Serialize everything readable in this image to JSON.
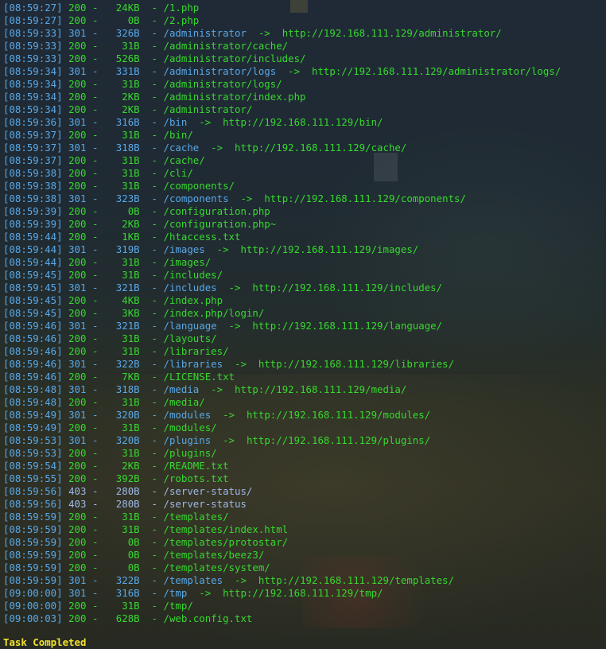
{
  "colors": {
    "status_200": "#37d82f",
    "status_301": "#58a8e8",
    "status_403": "#9fb8e8",
    "task_text": "#f2e12c"
  },
  "scan_results": [
    {
      "time": "[08:59:27]",
      "code": "200",
      "size": "24KB",
      "path": "/1.php",
      "redirect": ""
    },
    {
      "time": "[08:59:27]",
      "code": "200",
      "size": "0B",
      "path": "/2.php",
      "redirect": ""
    },
    {
      "time": "[08:59:33]",
      "code": "301",
      "size": "326B",
      "path": "/administrator",
      "redirect": "http://192.168.111.129/administrator/"
    },
    {
      "time": "[08:59:33]",
      "code": "200",
      "size": "31B",
      "path": "/administrator/cache/",
      "redirect": ""
    },
    {
      "time": "[08:59:33]",
      "code": "200",
      "size": "526B",
      "path": "/administrator/includes/",
      "redirect": ""
    },
    {
      "time": "[08:59:34]",
      "code": "301",
      "size": "331B",
      "path": "/administrator/logs",
      "redirect": "http://192.168.111.129/administrator/logs/"
    },
    {
      "time": "[08:59:34]",
      "code": "200",
      "size": "31B",
      "path": "/administrator/logs/",
      "redirect": ""
    },
    {
      "time": "[08:59:34]",
      "code": "200",
      "size": "2KB",
      "path": "/administrator/index.php",
      "redirect": ""
    },
    {
      "time": "[08:59:34]",
      "code": "200",
      "size": "2KB",
      "path": "/administrator/",
      "redirect": ""
    },
    {
      "time": "[08:59:36]",
      "code": "301",
      "size": "316B",
      "path": "/bin",
      "redirect": "http://192.168.111.129/bin/"
    },
    {
      "time": "[08:59:37]",
      "code": "200",
      "size": "31B",
      "path": "/bin/",
      "redirect": ""
    },
    {
      "time": "[08:59:37]",
      "code": "301",
      "size": "318B",
      "path": "/cache",
      "redirect": "http://192.168.111.129/cache/"
    },
    {
      "time": "[08:59:37]",
      "code": "200",
      "size": "31B",
      "path": "/cache/",
      "redirect": ""
    },
    {
      "time": "[08:59:38]",
      "code": "200",
      "size": "31B",
      "path": "/cli/",
      "redirect": ""
    },
    {
      "time": "[08:59:38]",
      "code": "200",
      "size": "31B",
      "path": "/components/",
      "redirect": ""
    },
    {
      "time": "[08:59:38]",
      "code": "301",
      "size": "323B",
      "path": "/components",
      "redirect": "http://192.168.111.129/components/"
    },
    {
      "time": "[08:59:39]",
      "code": "200",
      "size": "0B",
      "path": "/configuration.php",
      "redirect": ""
    },
    {
      "time": "[08:59:39]",
      "code": "200",
      "size": "2KB",
      "path": "/configuration.php~",
      "redirect": ""
    },
    {
      "time": "[08:59:44]",
      "code": "200",
      "size": "1KB",
      "path": "/htaccess.txt",
      "redirect": ""
    },
    {
      "time": "[08:59:44]",
      "code": "301",
      "size": "319B",
      "path": "/images",
      "redirect": "http://192.168.111.129/images/"
    },
    {
      "time": "[08:59:44]",
      "code": "200",
      "size": "31B",
      "path": "/images/",
      "redirect": ""
    },
    {
      "time": "[08:59:45]",
      "code": "200",
      "size": "31B",
      "path": "/includes/",
      "redirect": ""
    },
    {
      "time": "[08:59:45]",
      "code": "301",
      "size": "321B",
      "path": "/includes",
      "redirect": "http://192.168.111.129/includes/"
    },
    {
      "time": "[08:59:45]",
      "code": "200",
      "size": "4KB",
      "path": "/index.php",
      "redirect": ""
    },
    {
      "time": "[08:59:45]",
      "code": "200",
      "size": "3KB",
      "path": "/index.php/login/",
      "redirect": ""
    },
    {
      "time": "[08:59:46]",
      "code": "301",
      "size": "321B",
      "path": "/language",
      "redirect": "http://192.168.111.129/language/"
    },
    {
      "time": "[08:59:46]",
      "code": "200",
      "size": "31B",
      "path": "/layouts/",
      "redirect": ""
    },
    {
      "time": "[08:59:46]",
      "code": "200",
      "size": "31B",
      "path": "/libraries/",
      "redirect": ""
    },
    {
      "time": "[08:59:46]",
      "code": "301",
      "size": "322B",
      "path": "/libraries",
      "redirect": "http://192.168.111.129/libraries/"
    },
    {
      "time": "[08:59:46]",
      "code": "200",
      "size": "7KB",
      "path": "/LICENSE.txt",
      "redirect": ""
    },
    {
      "time": "[08:59:48]",
      "code": "301",
      "size": "318B",
      "path": "/media",
      "redirect": "http://192.168.111.129/media/"
    },
    {
      "time": "[08:59:48]",
      "code": "200",
      "size": "31B",
      "path": "/media/",
      "redirect": ""
    },
    {
      "time": "[08:59:49]",
      "code": "301",
      "size": "320B",
      "path": "/modules",
      "redirect": "http://192.168.111.129/modules/"
    },
    {
      "time": "[08:59:49]",
      "code": "200",
      "size": "31B",
      "path": "/modules/",
      "redirect": ""
    },
    {
      "time": "[08:59:53]",
      "code": "301",
      "size": "320B",
      "path": "/plugins",
      "redirect": "http://192.168.111.129/plugins/"
    },
    {
      "time": "[08:59:53]",
      "code": "200",
      "size": "31B",
      "path": "/plugins/",
      "redirect": ""
    },
    {
      "time": "[08:59:54]",
      "code": "200",
      "size": "2KB",
      "path": "/README.txt",
      "redirect": ""
    },
    {
      "time": "[08:59:55]",
      "code": "200",
      "size": "392B",
      "path": "/robots.txt",
      "redirect": ""
    },
    {
      "time": "[08:59:56]",
      "code": "403",
      "size": "280B",
      "path": "/server-status/",
      "redirect": ""
    },
    {
      "time": "[08:59:56]",
      "code": "403",
      "size": "280B",
      "path": "/server-status",
      "redirect": ""
    },
    {
      "time": "[08:59:59]",
      "code": "200",
      "size": "31B",
      "path": "/templates/",
      "redirect": ""
    },
    {
      "time": "[08:59:59]",
      "code": "200",
      "size": "31B",
      "path": "/templates/index.html",
      "redirect": ""
    },
    {
      "time": "[08:59:59]",
      "code": "200",
      "size": "0B",
      "path": "/templates/protostar/",
      "redirect": ""
    },
    {
      "time": "[08:59:59]",
      "code": "200",
      "size": "0B",
      "path": "/templates/beez3/",
      "redirect": ""
    },
    {
      "time": "[08:59:59]",
      "code": "200",
      "size": "0B",
      "path": "/templates/system/",
      "redirect": ""
    },
    {
      "time": "[08:59:59]",
      "code": "301",
      "size": "322B",
      "path": "/templates",
      "redirect": "http://192.168.111.129/templates/"
    },
    {
      "time": "[09:00:00]",
      "code": "301",
      "size": "316B",
      "path": "/tmp",
      "redirect": "http://192.168.111.129/tmp/"
    },
    {
      "time": "[09:00:00]",
      "code": "200",
      "size": "31B",
      "path": "/tmp/",
      "redirect": ""
    },
    {
      "time": "[09:00:03]",
      "code": "200",
      "size": "628B",
      "path": "/web.config.txt",
      "redirect": ""
    }
  ],
  "separator": "-",
  "arrow": "->",
  "task_status": "Task Completed"
}
